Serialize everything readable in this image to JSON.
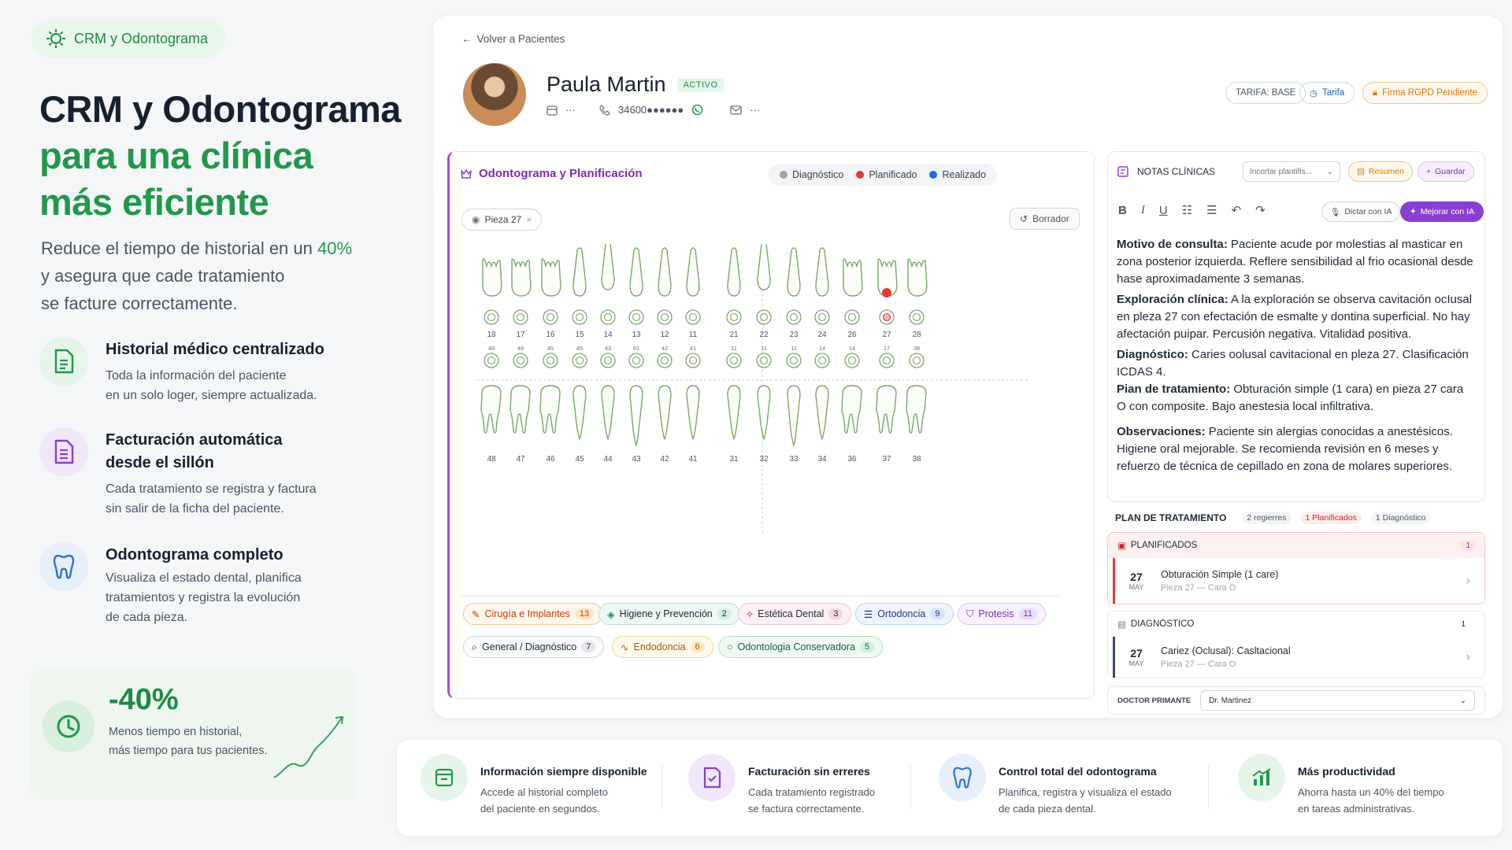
{
  "brand": {
    "label": "CRM y Odontograma"
  },
  "hero": {
    "line1": "CRM y Odontograma",
    "line2": "para una clínica",
    "line3": "más eficiente"
  },
  "lead": {
    "text1": "Reduce el tiempo de historial en un ",
    "pct": "40%",
    "text2": "y asegura que cade tratamiento",
    "text3": "se facture correctamente."
  },
  "features": [
    {
      "title": "Historial médico centralizado",
      "desc1": "Toda la información del paciente",
      "desc2": "en un solo loger, siempre actualizada."
    },
    {
      "title": "Facturación automática",
      "title2": "desde el sillón",
      "desc1": "Cada tratamiento se registra y factura",
      "desc2": "sin salir de la ficha del paciente."
    },
    {
      "title": "Odontograma completo",
      "desc1": "Visualiza el estado dental, planifica",
      "desc2": "tratamientos y registra la evolución",
      "desc3": "de cada pieza."
    }
  ],
  "stat": {
    "value": "-40%",
    "line1": "Menos tiempo en historial,",
    "line2": "más tiempo para tus pacientes."
  },
  "patient": {
    "back": "Volver a Pacientes",
    "name": "Paula Martin",
    "status": "ACTIVO",
    "dots": "···",
    "phone": "34600●●●●●●",
    "mail_dots": "···",
    "tarifa_label": "TARIFA: BASE",
    "tarifa_btn": "Tarifa",
    "rgpd_btn": "Firma RGPD Pendiente"
  },
  "colors": {
    "accent_green": "#22984a",
    "accent_purple": "#8b3fd0",
    "planned_red": "#e53935",
    "done_blue": "#1e6fd9",
    "diag_gray": "#9ca3af"
  },
  "odontogram": {
    "title": "Odontograma y Planificación",
    "legend": [
      "Diagnóstico",
      "Planificado",
      "Realizado"
    ],
    "pieza_chip": "Pieza 27",
    "borrar": "Borrador",
    "upper_labels": [
      "18",
      "17",
      "16",
      "15",
      "14",
      "13",
      "12",
      "11",
      "21",
      "22",
      "23",
      "24",
      "26",
      "27",
      "28"
    ],
    "upper_small": [
      "48",
      "49",
      "45",
      "45",
      "43",
      "61",
      "42",
      "41",
      "11",
      "11",
      "11",
      "14",
      "14",
      "17",
      "38"
    ],
    "lower_labels": [
      "48",
      "47",
      "46",
      "45",
      "44",
      "43",
      "42",
      "41",
      "31",
      "32",
      "33",
      "34",
      "36",
      "37",
      "38"
    ],
    "categories": [
      {
        "label": "Cirugía e Implantes",
        "count": "13"
      },
      {
        "label": "Higiene y Prevención",
        "count": "2"
      },
      {
        "label": "Estética Dental",
        "count": "3"
      },
      {
        "label": "Ortodoncia",
        "count": "9"
      },
      {
        "label": "Protesis",
        "count": "11"
      },
      {
        "label": "General / Diagnóstico",
        "count": "7"
      },
      {
        "label": "Endodoncia",
        "count": "6"
      },
      {
        "label": "Odontologia Conservadora",
        "count": "5"
      }
    ]
  },
  "notes": {
    "title": "NOTAS CLÍNICAS",
    "template_placeholder": "Incortar plantifis...",
    "resumen": "Resumen",
    "guardar": "Guardar",
    "dictar": "Dictar con IA",
    "mejorar": "Mejorar con IA",
    "motivo_label": "Motivo de consulta:",
    "motivo": " Paciente acude por molestias al masticar en zona posterior izquierda. Reflere sensibilidad al frio ocasional desde hase aproximadamente 3 semanas.",
    "explor_label": "Exploración clínica:",
    "explor": " A la exploración se observa cavitación ocIusal en pleza 27 con efectación de esmalte y dontina superficial. No hay afectación puipar. Percusión negativa. Vitalidad positiva.",
    "diag_label": "Diagnóstico:",
    "diag": " Caries oolusal cavitacional en pleza 27. Clasificación ICDAS 4.",
    "plan_label": "Pian de tratamiento:",
    "plan": " Obturación simple (1 cara) en pieza 27 cara O con composite. Bajo anestesia local infiltrativa.",
    "obs_label": "Observaciones:",
    "obs": " Paciente sin alergias conocidas a anestésicos. Higiene oral mejorable. Se recomienda revisión en 6 meses y refuerzo de técnica de cepillado en zona de molares superiores."
  },
  "plan": {
    "title": "PLAN DE TRATAMIENTO",
    "pills": [
      "2 regierres",
      "1 Planificados",
      "1 Diagnóstico"
    ],
    "planned_label": "PLANIFICADOS",
    "planned_count": "1",
    "item1": {
      "day": "27",
      "month": "MAY",
      "title": "Obturación Simple (1 care)",
      "sub": "Pieza 27 — Cara O"
    },
    "diag_label": "DIAGNÓSTICO",
    "diag_count": "1",
    "item2": {
      "day": "27",
      "month": "MAY",
      "title": "Cariez (Oclusal): Casltacional",
      "sub": "Pieza 27 — Cara O"
    },
    "doctor_label": "DOCTOR PRIMANTE",
    "doctor": "Dr. Martinez"
  },
  "footer": [
    {
      "title": "Información siempre disponible",
      "d1": "Accede al historial completo",
      "d2": "del paciente en segundos."
    },
    {
      "title": "Facturación sin erreres",
      "d1": "Cada tratamiento registrado",
      "d2": "se factura correctamente."
    },
    {
      "title": "Control total del odontograma",
      "d1": "Planifica, registra y visualiza el estado",
      "d2": "de cada pieza dental."
    },
    {
      "title": "Más productividad",
      "d1": "Ahorra hasta un 40% del tiempo",
      "d2": "en tareas administrativas."
    }
  ]
}
